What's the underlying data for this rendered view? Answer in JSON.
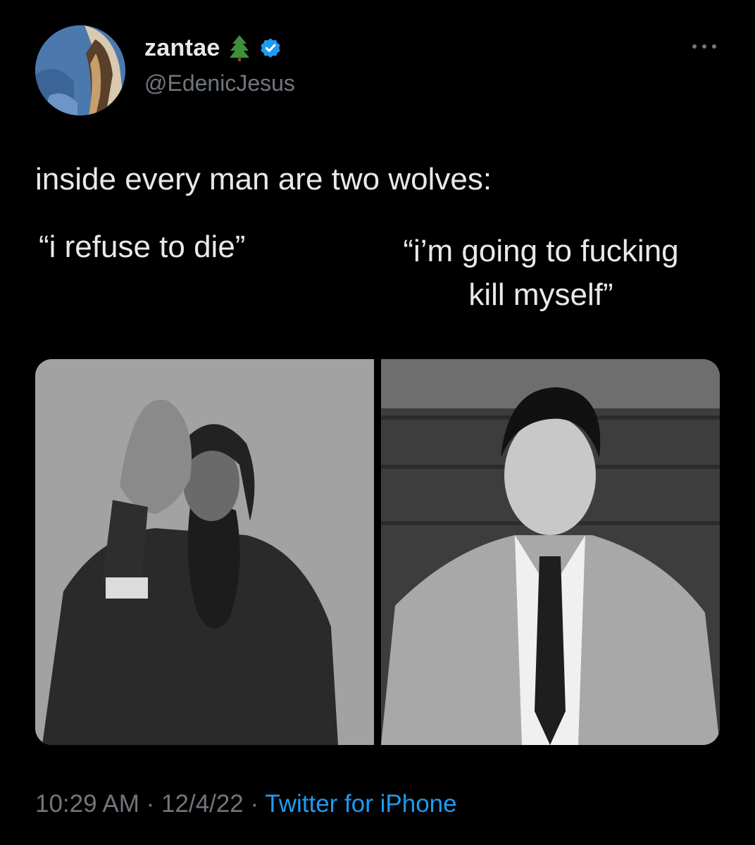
{
  "author": {
    "display_name": "zantae",
    "handle": "@EdenicJesus",
    "name_emoji": "evergreen-tree-icon",
    "verified": true
  },
  "tweet": {
    "line1": "inside every man are two wolves:",
    "quote_left": "“i refuse to die”",
    "quote_right_1": "“i’m going to fucking",
    "quote_right_2": "kill myself”"
  },
  "media": [
    {
      "name": "photo-bearded-man",
      "kind": "black-and-white photograph"
    },
    {
      "name": "photo-man-in-suit",
      "kind": "black-and-white photograph"
    }
  ],
  "meta": {
    "time": "10:29 AM",
    "sep1": " · ",
    "date": "12/4/22",
    "sep2": " · ",
    "source": "Twitter for iPhone"
  },
  "colors": {
    "background": "#000000",
    "text_primary": "#e7e9ea",
    "text_secondary": "#71767b",
    "link": "#1d9bf0",
    "verified": "#1d9bf0"
  }
}
